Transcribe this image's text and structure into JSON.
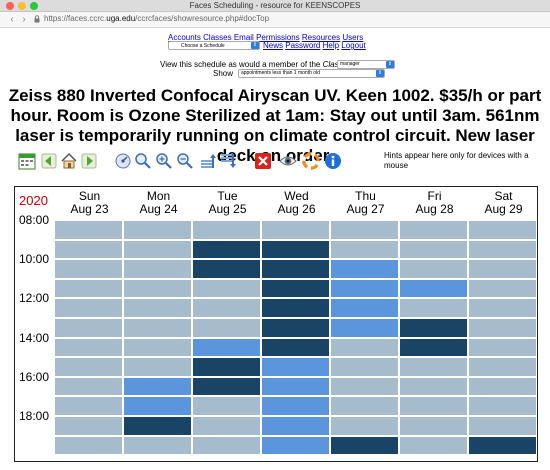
{
  "window": {
    "title": "Faces Scheduling - resource for KEENSCOPES"
  },
  "browser": {
    "url_prefix": "https://faces.ccrc.",
    "url_domain": "uga.edu",
    "url_suffix": "/ccrcfaces/showresource.php#docTop"
  },
  "menu": {
    "row1": [
      "Accounts",
      "Classes",
      "Email",
      "Permissions",
      "Resources",
      "Users"
    ],
    "row2": [
      "News",
      "Password",
      "Help",
      "Logout"
    ],
    "schedule_select": "Choose a Schedule"
  },
  "view": {
    "label_prefix": "View this schedule as would a member of the",
    "label_class": "Class",
    "class_value": "manager",
    "show_label": "Show",
    "show_value": "appointments less than 1 month old"
  },
  "headline": "Zeiss 880 Inverted Confocal Airyscan UV. Keen 1002. $35/h or part hour. Room is Ozone Sterilized at 1am: Stay out until 3am. 561nm laser is temporarily running on climate control circuit. New laser deck on order.",
  "toolbar": {
    "icons": [
      "calendar-icon",
      "back-icon",
      "home-icon",
      "forward-icon",
      "settings-icon",
      "zoom-icon",
      "zoom-in-icon",
      "zoom-out-icon",
      "scroll-up-icon",
      "scroll-down-icon",
      "close-icon",
      "eye-icon",
      "lifebuoy-icon",
      "info-icon"
    ],
    "hints": "Hints appear here only for devices with a mouse"
  },
  "calendar": {
    "year": "2020",
    "days": [
      {
        "dow": "Sun",
        "date": "Aug 23"
      },
      {
        "dow": "Mon",
        "date": "Aug 24"
      },
      {
        "dow": "Tue",
        "date": "Aug 25"
      },
      {
        "dow": "Wed",
        "date": "Aug 26"
      },
      {
        "dow": "Thu",
        "date": "Aug 27"
      },
      {
        "dow": "Fri",
        "date": "Aug 28"
      },
      {
        "dow": "Sat",
        "date": "Aug 29"
      }
    ],
    "time_labels": [
      "08:00",
      "10:00",
      "12:00",
      "14:00",
      "16:00",
      "18:00"
    ],
    "colors": {
      "free": "#a6bccc",
      "booked": "#5b95db",
      "busy": "#1a4466",
      "grid": "#ffffff"
    },
    "slots": [
      [
        "free",
        "free",
        "free",
        "free",
        "free",
        "free",
        "free"
      ],
      [
        "free",
        "free",
        "busy",
        "busy",
        "free",
        "free",
        "free"
      ],
      [
        "free",
        "free",
        "busy",
        "busy",
        "booked",
        "free",
        "free"
      ],
      [
        "free",
        "free",
        "free",
        "busy",
        "booked",
        "booked",
        "free"
      ],
      [
        "free",
        "free",
        "free",
        "busy",
        "booked",
        "free",
        "free"
      ],
      [
        "free",
        "free",
        "free",
        "busy",
        "booked",
        "busy",
        "free"
      ],
      [
        "free",
        "free",
        "booked",
        "busy",
        "free",
        "busy",
        "free"
      ],
      [
        "free",
        "free",
        "busy",
        "booked",
        "free",
        "free",
        "free"
      ],
      [
        "free",
        "booked",
        "busy",
        "booked",
        "free",
        "free",
        "free"
      ],
      [
        "free",
        "booked",
        "free",
        "booked",
        "free",
        "free",
        "free"
      ],
      [
        "free",
        "busy",
        "free",
        "booked",
        "free",
        "free",
        "free"
      ],
      [
        "free",
        "free",
        "free",
        "booked",
        "busy",
        "free",
        "busy"
      ]
    ]
  }
}
